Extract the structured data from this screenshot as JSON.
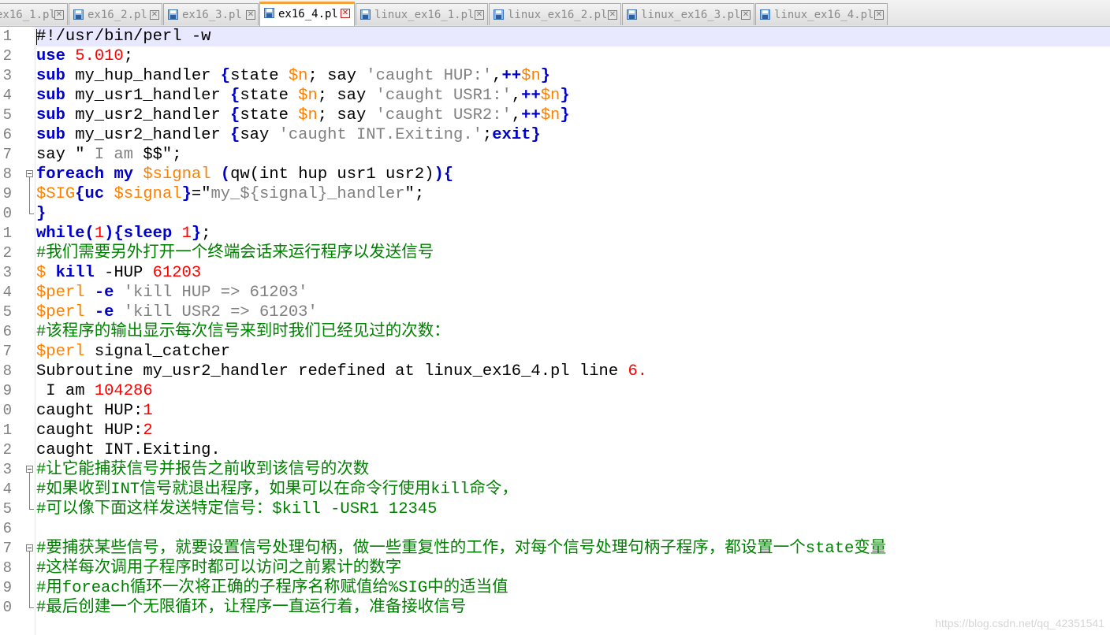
{
  "tabs": [
    {
      "label": "ex16_1.pl",
      "active": false
    },
    {
      "label": "ex16_2.pl",
      "active": false
    },
    {
      "label": "ex16_3.pl",
      "active": false
    },
    {
      "label": "ex16_4.pl",
      "active": true
    },
    {
      "label": "linux_ex16_1.pl",
      "active": false
    },
    {
      "label": "linux_ex16_2.pl",
      "active": false
    },
    {
      "label": "linux_ex16_3.pl",
      "active": false
    },
    {
      "label": "linux_ex16_4.pl",
      "active": false
    }
  ],
  "icons": {
    "tab_file": "save-file-icon",
    "tab_close": "close-icon",
    "fold": "fold-minus-icon"
  },
  "colors": {
    "keyword": "#0000cc",
    "number": "#ff0000",
    "variable": "#ff8000",
    "string": "#808080",
    "comment": "#008000",
    "current_line": "#e8e8ff",
    "active_tab_accent": "#f2a33a"
  },
  "editor": {
    "line_numbers": [
      "1",
      "2",
      "3",
      "4",
      "5",
      "6",
      "7",
      "8",
      "9",
      "0",
      "1",
      "2",
      "3",
      "4",
      "5",
      "6",
      "7",
      "8",
      "9",
      "0",
      "1",
      "2",
      "3",
      "4",
      "5",
      "6",
      "7",
      "8",
      "9",
      "0"
    ],
    "lines": [
      [
        [
          "#!/usr/bin/perl -w",
          ""
        ]
      ],
      [
        [
          "use",
          "k"
        ],
        [
          " ",
          ""
        ],
        [
          "5.010",
          "n"
        ],
        [
          ";",
          ""
        ]
      ],
      [
        [
          "sub",
          "k"
        ],
        [
          " my_hup_handler ",
          ""
        ],
        [
          "{",
          "k"
        ],
        [
          "state ",
          ""
        ],
        [
          "$n",
          "v"
        ],
        [
          "; say ",
          ""
        ],
        [
          "'caught HUP:'",
          "s"
        ],
        [
          ",",
          ""
        ],
        [
          "++",
          "k"
        ],
        [
          "$n",
          "v"
        ],
        [
          "}",
          "k"
        ]
      ],
      [
        [
          "sub",
          "k"
        ],
        [
          " my_usr1_handler ",
          ""
        ],
        [
          "{",
          "k"
        ],
        [
          "state ",
          ""
        ],
        [
          "$n",
          "v"
        ],
        [
          "; say ",
          ""
        ],
        [
          "'caught USR1:'",
          "s"
        ],
        [
          ",",
          ""
        ],
        [
          "++",
          "k"
        ],
        [
          "$n",
          "v"
        ],
        [
          "}",
          "k"
        ]
      ],
      [
        [
          "sub",
          "k"
        ],
        [
          " my_usr2_handler ",
          ""
        ],
        [
          "{",
          "k"
        ],
        [
          "state ",
          ""
        ],
        [
          "$n",
          "v"
        ],
        [
          "; say ",
          ""
        ],
        [
          "'caught USR2:'",
          "s"
        ],
        [
          ",",
          ""
        ],
        [
          "++",
          "k"
        ],
        [
          "$n",
          "v"
        ],
        [
          "}",
          "k"
        ]
      ],
      [
        [
          "sub",
          "k"
        ],
        [
          " my_usr2_handler ",
          ""
        ],
        [
          "{",
          "k"
        ],
        [
          "say ",
          ""
        ],
        [
          "'caught INT.Exiting.'",
          "s"
        ],
        [
          ";",
          ""
        ],
        [
          "exit",
          "k"
        ],
        [
          "}",
          "k"
        ]
      ],
      [
        [
          "say \" ",
          ""
        ],
        [
          "I am",
          "s"
        ],
        [
          " $$\";",
          ""
        ]
      ],
      [
        [
          "foreach",
          "k"
        ],
        [
          " ",
          ""
        ],
        [
          "my",
          "k"
        ],
        [
          " ",
          ""
        ],
        [
          "$signal",
          "v"
        ],
        [
          " ",
          ""
        ],
        [
          "(",
          "k"
        ],
        [
          "qw(int hup usr1 usr2)",
          ""
        ],
        [
          ")",
          "k"
        ],
        [
          "{",
          "k"
        ]
      ],
      [
        [
          "$SIG",
          "v"
        ],
        [
          "{",
          "k"
        ],
        [
          "uc",
          "k"
        ],
        [
          " ",
          ""
        ],
        [
          "$signal",
          "v"
        ],
        [
          "}",
          "k"
        ],
        [
          "=\"",
          ""
        ],
        [
          "my_${signal}_handler",
          "s"
        ],
        [
          "\";",
          ""
        ]
      ],
      [
        [
          "}",
          "k"
        ]
      ],
      [
        [
          "while",
          "k"
        ],
        [
          "(",
          "k"
        ],
        [
          "1",
          "n"
        ],
        [
          ")",
          "k"
        ],
        [
          "{",
          "k"
        ],
        [
          "sleep",
          "k"
        ],
        [
          " ",
          ""
        ],
        [
          "1",
          "n"
        ],
        [
          "}",
          "k"
        ],
        [
          ";",
          ""
        ]
      ],
      [
        [
          "#我们需要另外打开一个终端会话来运行程序以发送信号",
          "c"
        ]
      ],
      [
        [
          "$",
          "v"
        ],
        [
          " ",
          ""
        ],
        [
          "kill",
          "k"
        ],
        [
          " -HUP ",
          ""
        ],
        [
          "61203",
          "n"
        ]
      ],
      [
        [
          "$perl",
          "v"
        ],
        [
          " ",
          ""
        ],
        [
          "-e",
          "k"
        ],
        [
          " ",
          ""
        ],
        [
          "'kill HUP => 61203'",
          "s"
        ]
      ],
      [
        [
          "$perl",
          "v"
        ],
        [
          " ",
          ""
        ],
        [
          "-e",
          "k"
        ],
        [
          " ",
          ""
        ],
        [
          "'kill USR2 => 61203'",
          "s"
        ]
      ],
      [
        [
          "#该程序的输出显示每次信号来到时我们已经见过的次数：",
          "c"
        ]
      ],
      [
        [
          "$perl",
          "v"
        ],
        [
          " signal_catcher",
          ""
        ]
      ],
      [
        [
          "Subroutine my_usr2_handler redefined at linux_ex16_4.pl line ",
          ""
        ],
        [
          "6.",
          "n"
        ]
      ],
      [
        [
          " I am ",
          ""
        ],
        [
          "104286",
          "n"
        ]
      ],
      [
        [
          "caught HUP:",
          ""
        ],
        [
          "1",
          "n"
        ]
      ],
      [
        [
          "caught HUP:",
          ""
        ],
        [
          "2",
          "n"
        ]
      ],
      [
        [
          "caught INT.Exiting.",
          ""
        ]
      ],
      [
        [
          "#让它能捕获信号并报告之前收到该信号的次数",
          "c"
        ]
      ],
      [
        [
          "#如果收到INT信号就退出程序，如果可以在命令行使用kill命令，",
          "c"
        ]
      ],
      [
        [
          "#可以像下面这样发送特定信号：$kill -USR1 12345",
          "c"
        ]
      ],
      [],
      [
        [
          "#要捕获某些信号，就要设置信号处理句柄，做一些重复性的工作，对每个信号处理句柄子程序，都设置一个state变量",
          "c"
        ]
      ],
      [
        [
          "#这样每次调用子程序时都可以访问之前累计的数字",
          "c"
        ]
      ],
      [
        [
          "#用foreach循环一次将正确的子程序名称赋值给%SIG中的适当值",
          "c"
        ]
      ],
      [
        [
          "#最后创建一个无限循环，让程序一直运行着，准备接收信号",
          "c"
        ]
      ]
    ]
  },
  "watermark": "https://blog.csdn.net/qq_42351541"
}
